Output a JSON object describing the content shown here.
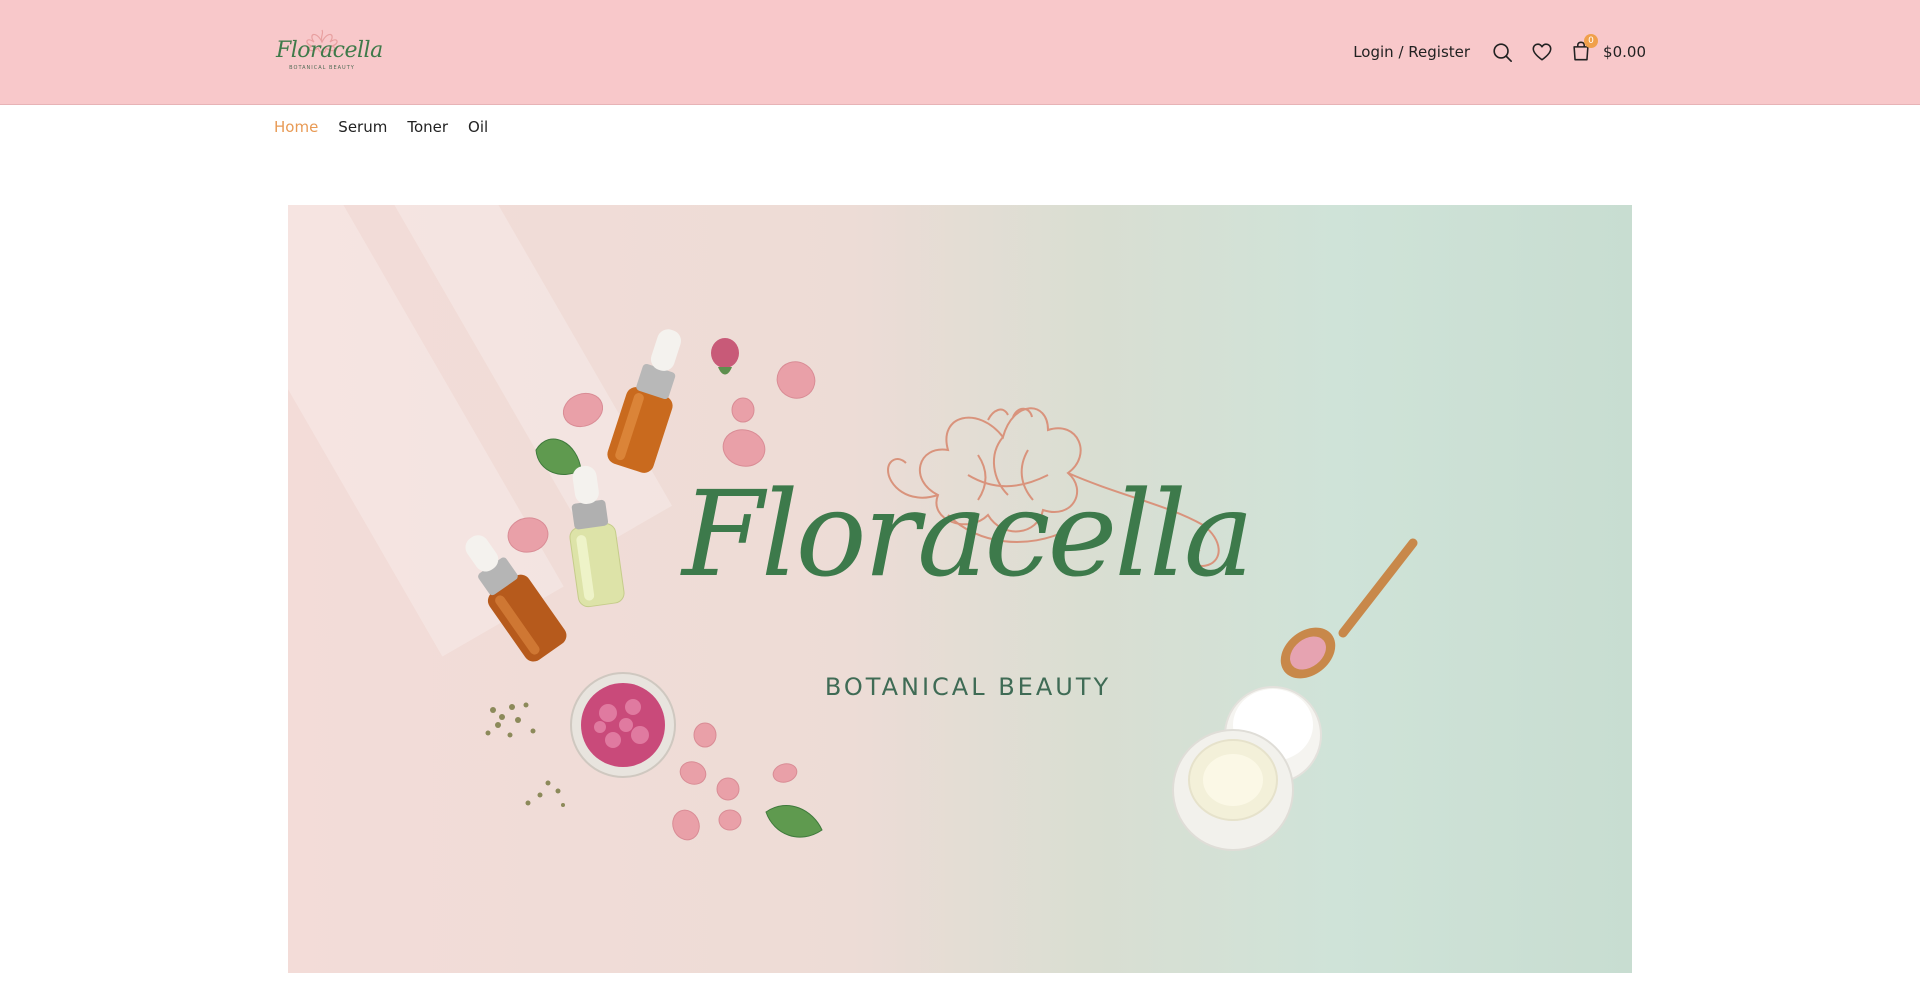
{
  "brand": {
    "logo_wordmark": "Floracella",
    "logo_tagline": "BOTANICAL BEAUTY",
    "accent_color": "#e89a55",
    "header_bg": "#f8c8ca",
    "logo_green": "#3d7a4b"
  },
  "header": {
    "login_label": "Login / Register",
    "search_icon": "search-icon",
    "wishlist_icon": "heart-icon",
    "cart_icon": "shopping-bag-icon",
    "cart_count": "0",
    "cart_total": "$0.00"
  },
  "nav": {
    "items": [
      {
        "label": "Home",
        "active": true
      },
      {
        "label": "Serum",
        "active": false
      },
      {
        "label": "Toner",
        "active": false
      },
      {
        "label": "Oil",
        "active": false
      }
    ]
  },
  "hero": {
    "wordmark": "Floracella",
    "tagline": "BOTANICAL BEAUTY"
  }
}
